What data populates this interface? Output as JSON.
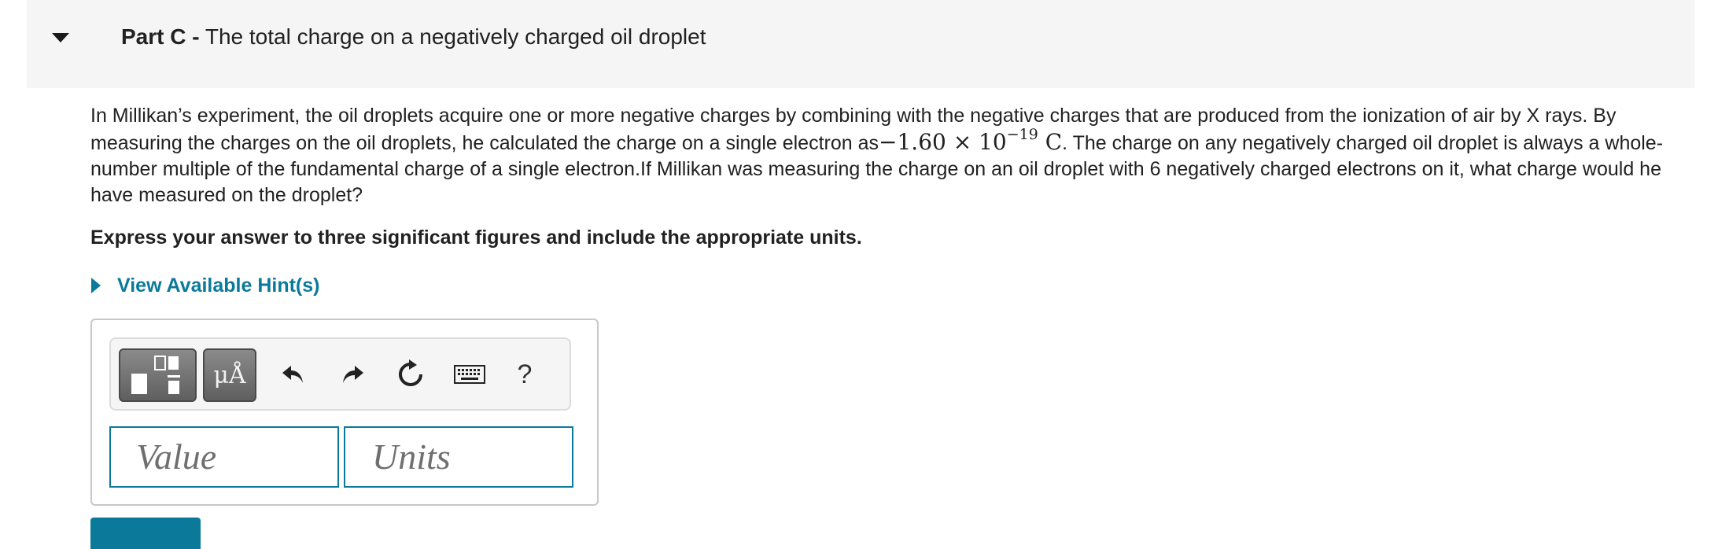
{
  "part": {
    "label": "Part C -",
    "title": "The total charge on a negatively charged oil droplet"
  },
  "problem": {
    "text_before": "In Millikan’s experiment, the oil droplets acquire one or more negative charges by combining with the negative charges that are produced from the ionization of air by X rays. By measuring the charges on the oil droplets, he calculated the charge on a single electron as",
    "charge_mantissa": "−1.60 × 10",
    "charge_exponent": "−19",
    "charge_unit": "C",
    "text_after": ". The charge on any negatively charged oil droplet is always a whole-number multiple of the fundamental charge of a single electron.If Millikan was measuring the charge on an oil droplet with 6 negatively charged electrons on it, what charge would he have measured on the droplet?"
  },
  "instruction": "Express your answer to three significant figures and include the appropriate units.",
  "hints": {
    "label": "View Available Hint(s)"
  },
  "toolbar": {
    "units_label": "μÅ",
    "help_label": "?"
  },
  "answer": {
    "value_placeholder": "Value",
    "units_placeholder": "Units"
  },
  "colors": {
    "accent": "#0b7a9a",
    "header_bg": "#f5f5f5"
  }
}
